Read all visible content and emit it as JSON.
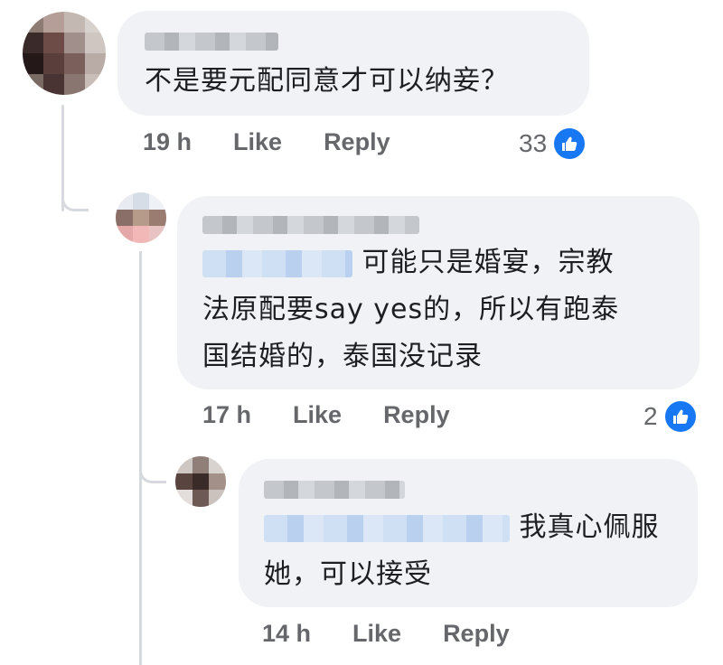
{
  "comments": [
    {
      "text": "不是要元配同意才可以纳妾？",
      "time": "19 h",
      "like_label": "Like",
      "reply_label": "Reply",
      "reaction_count": "33"
    },
    {
      "text_line1": "可能只是婚宴，宗教",
      "text_line2": "法原配要say yes的，所以有跑泰",
      "text_line3": "国结婚的，泰国没记录",
      "time": "17 h",
      "like_label": "Like",
      "reply_label": "Reply",
      "reaction_count": "2"
    },
    {
      "text_line1": "我真心佩服",
      "text_line2": "她，可以接受",
      "time": "14 h",
      "like_label": "Like",
      "reply_label": "Reply"
    }
  ],
  "colors": {
    "bubble": "#f0f2f5",
    "meta_text": "#65676b",
    "like_blue": "#1877f2",
    "thread_line": "#d6d9dd"
  },
  "icons": {
    "reaction": "thumbs-up-icon"
  }
}
